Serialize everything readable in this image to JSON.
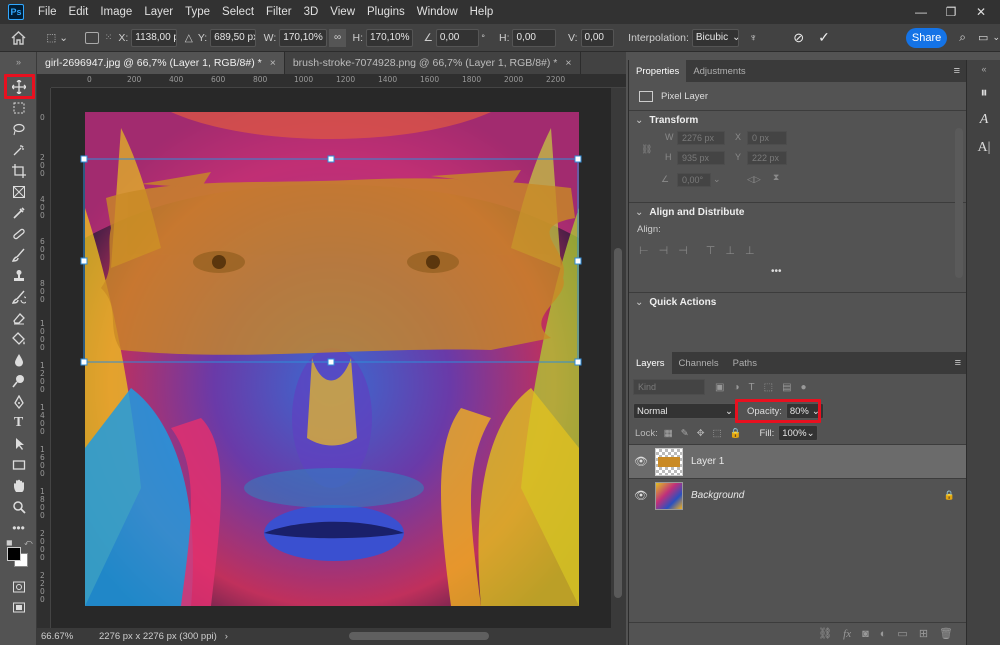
{
  "app": {
    "logo": "Ps"
  },
  "menu": [
    "File",
    "Edit",
    "Image",
    "Layer",
    "Type",
    "Select",
    "Filter",
    "3D",
    "View",
    "Plugins",
    "Window",
    "Help"
  ],
  "options": {
    "x_label": "X:",
    "x_value": "1138,00 p",
    "y_label": "Y:",
    "y_value": "689,50 px",
    "w_label": "W:",
    "w_value": "170,10%",
    "h_label": "H:",
    "h_value": "170,10%",
    "angle_value": "0,00",
    "hskew_label": "H:",
    "hskew_value": "0,00",
    "vskew_label": "V:",
    "vskew_value": "0,00",
    "interp_label": "Interpolation:",
    "interp_value": "Bicubic",
    "share_label": "Share"
  },
  "tabs": [
    {
      "label": "girl-2696947.jpg @ 66,7% (Layer 1, RGB/8#) *",
      "close": "×"
    },
    {
      "label": "brush-stroke-7074928.png @ 66,7% (Layer 1, RGB/8#) *",
      "close": "×"
    }
  ],
  "hruler": [
    "0",
    "200",
    "400",
    "600",
    "800",
    "1000",
    "1200",
    "1400",
    "1600",
    "1800",
    "2000",
    "2200"
  ],
  "vruler": [
    "0",
    "2 0 0",
    "4 0 0",
    "6 0 0",
    "8 0 0",
    "1 0 0 0",
    "1 2 0 0",
    "1 4 0 0",
    "1 6 0 0",
    "1 8 0 0",
    "2 0 0 0",
    "2 2 0 0"
  ],
  "status": {
    "zoom": "66.67%",
    "doc": "2276 px x 2276 px (300 ppi)"
  },
  "properties": {
    "tabs": [
      "Properties",
      "Adjustments"
    ],
    "kind": "Pixel Layer",
    "transform_title": "Transform",
    "w_label": "W",
    "w_value": "2276 px",
    "x_label": "X",
    "x_value": "0 px",
    "h_label": "H",
    "h_value": "935 px",
    "y_label": "Y",
    "y_value": "222 px",
    "angle_value": "0,00°",
    "align_title": "Align and Distribute",
    "align_label": "Align:",
    "more": "•••",
    "quick_title": "Quick Actions"
  },
  "layers": {
    "tabs": [
      "Layers",
      "Channels",
      "Paths"
    ],
    "kind_placeholder": "Kind",
    "blend_mode": "Normal",
    "opacity_label": "Opacity:",
    "opacity_value": "80%",
    "lock_label": "Lock:",
    "fill_label": "Fill:",
    "fill_value": "100%",
    "items": [
      {
        "name": "Layer 1",
        "selected": true
      },
      {
        "name": "Background",
        "selected": false,
        "locked": true
      }
    ],
    "footer_icons": [
      "link-icon",
      "fx-icon",
      "mask-icon",
      "adjustment-icon",
      "group-icon",
      "new-layer-icon",
      "trash-icon"
    ]
  },
  "colors": {
    "highlight": "#e8101f",
    "accent": "#1473e6",
    "stroke": "#c98a25"
  }
}
